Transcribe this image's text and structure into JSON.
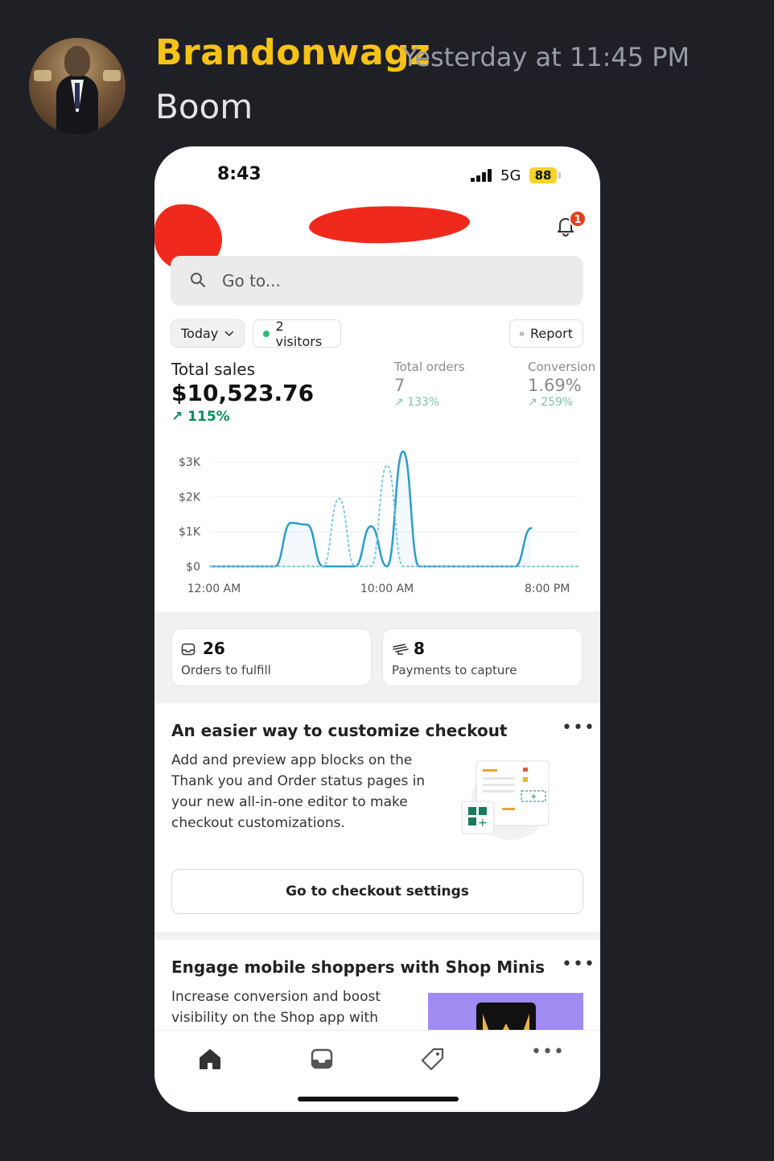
{
  "message": {
    "username": "Brandonwagz",
    "timestamp": "Yesterday at 11:45 PM",
    "text": "Boom",
    "username_color": "#f6c218"
  },
  "phone": {
    "status_time": "8:43",
    "network": "5G",
    "battery": "88",
    "notification_count": "1",
    "search_placeholder": "Go to...",
    "filters": {
      "period": "Today",
      "visitors": "2 visitors",
      "report": "Report"
    },
    "metrics": {
      "total_sales_label": "Total sales",
      "total_sales_value": "$10,523.76",
      "total_sales_change": "115%",
      "orders_label": "Total orders",
      "orders_value": "7",
      "orders_change": "133%",
      "conversion_label": "Conversion",
      "conversion_value": "1.69%",
      "conversion_change": "259%"
    },
    "tasks": [
      {
        "count": "26",
        "label": "Orders to fulfill",
        "icon": "inbox-icon"
      },
      {
        "count": "8",
        "label": "Payments to capture",
        "icon": "cash-icon"
      }
    ],
    "promo1": {
      "title": "An easier way to customize checkout",
      "body": "Add and preview app blocks on the Thank you and Order status pages in your new all-in-one editor to make checkout customizations.",
      "cta": "Go to checkout settings"
    },
    "promo2": {
      "title": "Engage mobile shoppers with Shop Minis",
      "body": "Increase conversion and boost visibility on the Shop app with"
    },
    "tabs": [
      "home-icon",
      "orders-icon",
      "tag-icon",
      "more-icon"
    ],
    "accent_green": "#0b8a5c",
    "chart_line_color": "#2d9cc8"
  },
  "chart_data": {
    "type": "line",
    "ylabel": "",
    "xlabel": "",
    "yticks": [
      "$3K",
      "$2K",
      "$1K",
      "$0"
    ],
    "xticks": [
      "12:00 AM",
      "10:00 AM",
      "8:00 PM"
    ],
    "ylim": [
      0,
      3000
    ],
    "x": [
      0,
      1,
      2,
      3,
      4,
      5,
      6,
      7,
      8,
      9,
      10,
      11,
      12,
      13,
      14,
      15,
      16,
      17,
      18,
      19,
      20,
      21,
      22,
      23
    ],
    "series": [
      {
        "style": "solid",
        "values": [
          0,
          0,
          0,
          0,
          0,
          1250,
          1200,
          0,
          0,
          0,
          1150,
          0,
          3300,
          0,
          0,
          0,
          0,
          0,
          0,
          0,
          1100,
          null,
          null,
          null
        ]
      },
      {
        "style": "dotted",
        "values": [
          0,
          0,
          0,
          0,
          0,
          0,
          0,
          0,
          1950,
          0,
          0,
          2900,
          0,
          0,
          0,
          0,
          0,
          0,
          0,
          0,
          0,
          0,
          0,
          0
        ]
      }
    ]
  }
}
